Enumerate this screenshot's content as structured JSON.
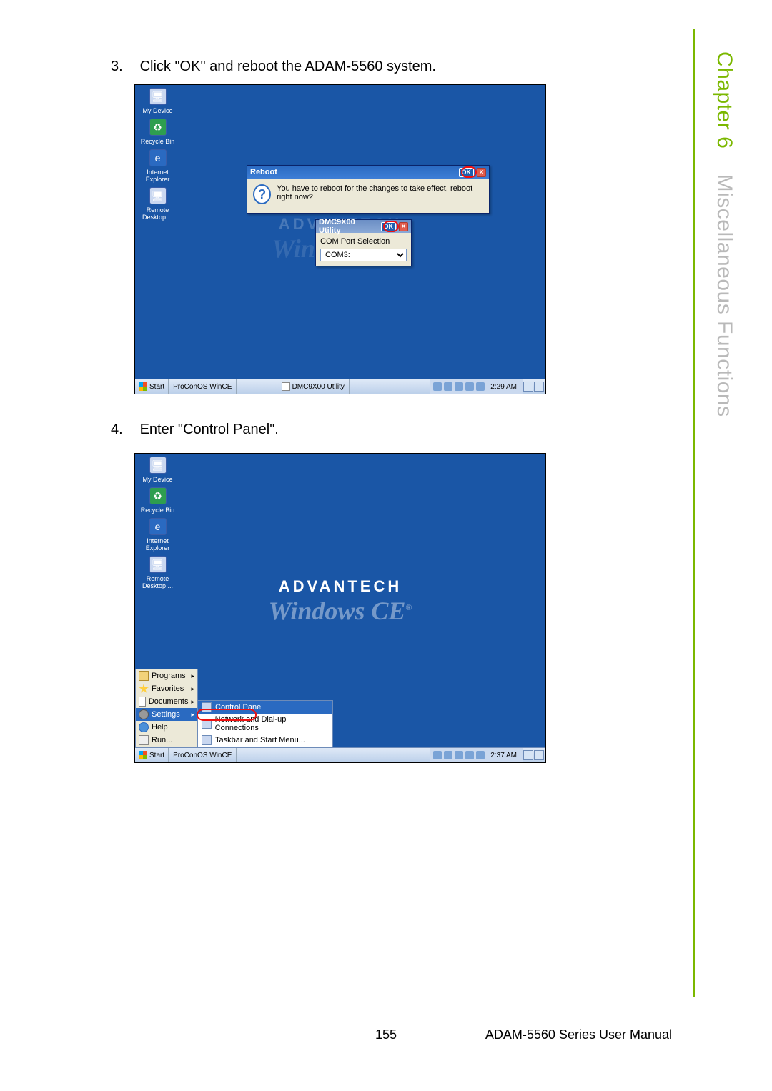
{
  "sidebar": {
    "chapter": "Chapter 6",
    "title": "Miscellaneous Functions"
  },
  "steps": {
    "s3": {
      "num": "3.",
      "text": "Click \"OK\" and reboot the ADAM-5560 system."
    },
    "s4": {
      "num": "4.",
      "text": "Enter \"Control Panel\"."
    }
  },
  "desktop": {
    "icons": [
      "My Device",
      "Recycle Bin",
      "Internet Explorer",
      "Remote Desktop ..."
    ]
  },
  "brand": {
    "top": "ADVANTECH",
    "bottom": "Windows CE"
  },
  "reboot_dialog": {
    "title": "Reboot",
    "ok": "OK",
    "message": "You have to reboot for the changes to take effect, reboot right now?"
  },
  "util_dialog": {
    "title": "DMC9X00 Utility",
    "ok": "OK",
    "label": "COM Port Selection",
    "value": "COM3:"
  },
  "taskbar1": {
    "start": "Start",
    "task": "ProConOS WinCE",
    "utility": "DMC9X00 Utility",
    "time": "2:29 AM"
  },
  "taskbar2": {
    "start": "Start",
    "task": "ProConOS WinCE",
    "time": "2:37 AM"
  },
  "start_menu": {
    "items": [
      {
        "label": "Programs",
        "arrow": true
      },
      {
        "label": "Favorites",
        "arrow": true
      },
      {
        "label": "Documents",
        "arrow": true
      },
      {
        "label": "Settings",
        "arrow": true,
        "selected": true
      },
      {
        "label": "Help",
        "arrow": false
      },
      {
        "label": "Run...",
        "arrow": false
      }
    ],
    "submenu": [
      {
        "label": "Control Panel",
        "selected": true
      },
      {
        "label": "Network and Dial-up Connections",
        "selected": false
      },
      {
        "label": "Taskbar and Start Menu...",
        "selected": false
      }
    ]
  },
  "footer": {
    "page": "155",
    "manual": "ADAM-5560 Series User Manual"
  }
}
